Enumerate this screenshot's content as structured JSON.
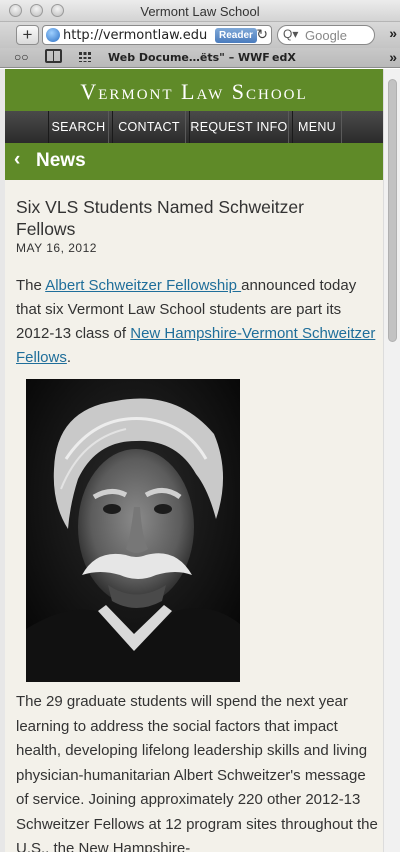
{
  "window": {
    "title": "Vermont Law School"
  },
  "toolbar": {
    "add_label": "+",
    "url": "http://vermontlaw.edu",
    "reader_label": "Reader",
    "reload_label": "↻",
    "search_placeholder": "Google",
    "overflow_label": "»"
  },
  "bookmarks": {
    "items": [
      "Web Docume…ëts\" – WWF",
      "edX"
    ],
    "overflow_label": "»"
  },
  "site": {
    "name": "Vermont Law School",
    "nav": [
      "SEARCH",
      "CONTACT",
      "REQUEST INFO",
      "MENU"
    ],
    "section": "News",
    "back_chevron": "‹"
  },
  "article": {
    "headline": "Six VLS Students Named Schweitzer Fellows",
    "date": "MAY 16, 2012",
    "intro": {
      "p1": "The ",
      "link1": "Albert Schweitzer Fellowship ",
      "p2": "announced today that six Vermont Law School students are part its 2012-13 class of ",
      "link2": "New Hampshire-Vermont Schweitzer Fellows",
      "p3": "."
    },
    "body": "The 29 graduate students will spend the next year learning to address the social factors that impact health, developing lifelong leadership skills and living physician-humanitarian Albert Schweitzer's message of service. Joining approximately 220 other 2012-13 Schweitzer Fellows at 12 program sites throughout the U.S., the New Hampshire-"
  },
  "colors": {
    "brand_green": "#5f8a28",
    "nav_dark": "#2b2b2b",
    "link_blue": "#1f6e9a",
    "page_bg": "#f3f1ea"
  }
}
